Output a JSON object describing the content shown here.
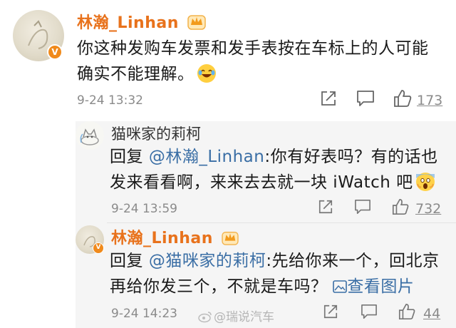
{
  "comments": [
    {
      "author": "林瀚_Linhan",
      "text_line1": "你这种发购车发票和发手表按在车标上的人可能",
      "text_line2": "确实不能理解。",
      "time": "9-24 13:32",
      "likes": "173",
      "emoji": "laughing-tears-emoji"
    }
  ],
  "replies": [
    {
      "author": "猫咪家的莉柯",
      "prefix": "回复",
      "mention": "@林瀚_Linhan",
      "text_line1_rest": ":你有好表吗？有的话也",
      "text_line2": "发来看看啊，来来去去就一块 iWatch 吧",
      "time": "9-24 13:59",
      "likes": "732",
      "emoji": "screaming-face-emoji"
    },
    {
      "author": "林瀚_Linhan",
      "prefix": "回复",
      "mention": "@猫咪家的莉柯",
      "text_line1_rest": ":先给你来一个，回北京",
      "text_line2": "再给你发三个，不就是车吗？",
      "view_image": "查看图片",
      "time": "9-24 14:23",
      "likes": "44"
    }
  ],
  "watermark": "@瑞说汽车",
  "colors": {
    "author_orange": "#e8721c",
    "mention_blue": "#3a6ea5",
    "meta_gray": "#8a8a8a",
    "reply_bg": "#f5f5f5"
  }
}
